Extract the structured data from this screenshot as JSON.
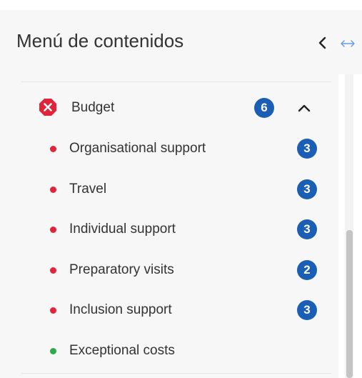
{
  "sidebar": {
    "title": "Menú de contenidos",
    "collapse_icon": "chevron-left-icon",
    "resize_icon": "resize-horizontal-icon"
  },
  "section": {
    "label": "Budget",
    "status": "error",
    "status_icon": "error-icon",
    "count": "6",
    "expanded": true,
    "toggle_icon": "chevron-up-icon",
    "items": [
      {
        "label": "Organisational support",
        "status": "error",
        "count": "3"
      },
      {
        "label": "Travel",
        "status": "error",
        "count": "3"
      },
      {
        "label": "Individual support",
        "status": "error",
        "count": "3"
      },
      {
        "label": "Preparatory visits",
        "status": "error",
        "count": "2"
      },
      {
        "label": "Inclusion support",
        "status": "error",
        "count": "3"
      },
      {
        "label": "Exceptional costs",
        "status": "ok",
        "count": null
      }
    ]
  },
  "colors": {
    "error": "#e0243a",
    "ok": "#2eaa4a",
    "badge": "#1a5fb4",
    "text": "#333333",
    "panel_background": "#f7f7f7",
    "resize_icon": "#6c9de0"
  }
}
